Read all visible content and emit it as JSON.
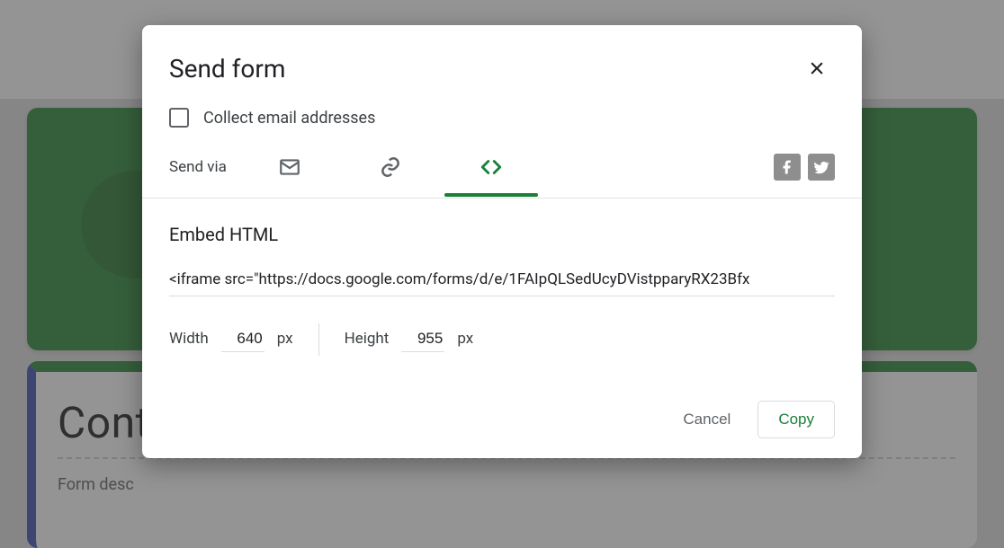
{
  "bg": {
    "title_partial": "Cont",
    "desc_partial": "Form desc"
  },
  "dialog": {
    "title": "Send form",
    "collect_label": "Collect email addresses",
    "send_via_label": "Send via",
    "tabs": {
      "email": "email-icon",
      "link": "link-icon",
      "embed": "embed-icon"
    },
    "section_title": "Embed HTML",
    "embed_value": "<iframe src=\"https://docs.google.com/forms/d/e/1FAIpQLSedUcyDVistpparyRX23Bfx",
    "width_label": "Width",
    "width_value": "640",
    "width_unit": "px",
    "height_label": "Height",
    "height_value": "955",
    "height_unit": "px",
    "cancel": "Cancel",
    "copy": "Copy"
  },
  "colors": {
    "accent": "#188038",
    "checkbox_border": "#5f6368"
  }
}
